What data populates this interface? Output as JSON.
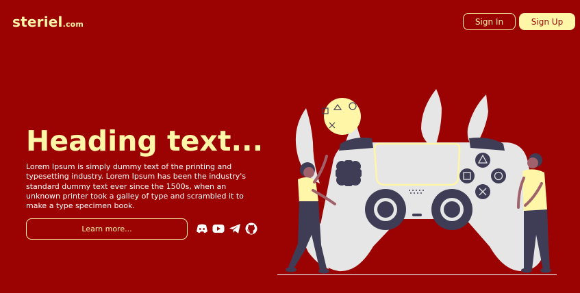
{
  "brand": {
    "name": "steriel",
    "domain": ".com"
  },
  "nav": {
    "signin_label": "Sign In",
    "signup_label": "Sign Up"
  },
  "hero": {
    "heading": "Heading text...",
    "description": "Lorem Ipsum is simply dummy text of the printing and typesetting industry. Lorem Ipsum has been the industry's standard dummy text ever since the 1500s, when an unknown printer took a galley of type and scrambled it to make a type specimen book.",
    "cta_label": "Learn more..."
  },
  "socials": [
    "discord-icon",
    "youtube-icon",
    "telegram-icon",
    "github-icon"
  ],
  "colors": {
    "background": "#9b0303",
    "accent": "#fff6a8",
    "controller": "#e6e6e6",
    "controller_dark": "#3f3d56"
  }
}
